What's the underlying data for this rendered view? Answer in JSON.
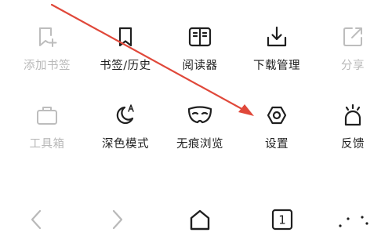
{
  "menu": {
    "row1": [
      {
        "label": "添加书签",
        "icon": "add-bookmark-icon",
        "disabled": true
      },
      {
        "label": "书签/历史",
        "icon": "bookmark-icon",
        "disabled": false
      },
      {
        "label": "阅读器",
        "icon": "reader-icon",
        "disabled": false
      },
      {
        "label": "下载管理",
        "icon": "download-icon",
        "disabled": false
      },
      {
        "label": "分享",
        "icon": "share-icon",
        "disabled": true
      }
    ],
    "row2": [
      {
        "label": "工具箱",
        "icon": "toolbox-icon",
        "disabled": true
      },
      {
        "label": "深色模式",
        "icon": "dark-mode-icon",
        "disabled": false
      },
      {
        "label": "无痕浏览",
        "icon": "incognito-mask-icon",
        "disabled": false
      },
      {
        "label": "设置",
        "icon": "settings-icon",
        "disabled": false
      },
      {
        "label": "反馈",
        "icon": "feedback-icon",
        "disabled": false
      }
    ]
  },
  "bottom_bar": {
    "tab_count": "1"
  },
  "colors": {
    "text": "#1f1f1f",
    "disabled": "#b9b9b9",
    "annotation_arrow": "#e0483a"
  }
}
